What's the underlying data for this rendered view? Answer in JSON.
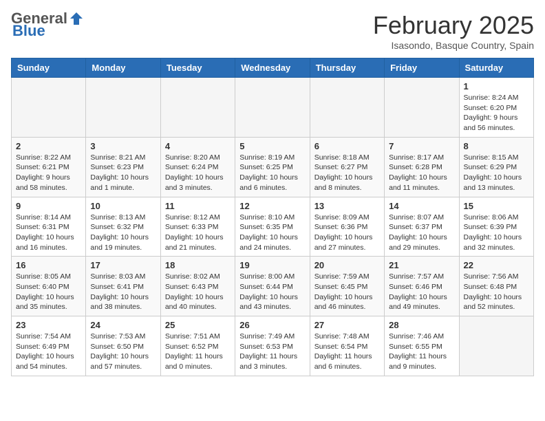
{
  "header": {
    "logo_general": "General",
    "logo_blue": "Blue",
    "month_title": "February 2025",
    "location": "Isasondo, Basque Country, Spain"
  },
  "weekdays": [
    "Sunday",
    "Monday",
    "Tuesday",
    "Wednesday",
    "Thursday",
    "Friday",
    "Saturday"
  ],
  "weeks": [
    [
      {
        "day": "",
        "info": ""
      },
      {
        "day": "",
        "info": ""
      },
      {
        "day": "",
        "info": ""
      },
      {
        "day": "",
        "info": ""
      },
      {
        "day": "",
        "info": ""
      },
      {
        "day": "",
        "info": ""
      },
      {
        "day": "1",
        "info": "Sunrise: 8:24 AM\nSunset: 6:20 PM\nDaylight: 9 hours and 56 minutes."
      }
    ],
    [
      {
        "day": "2",
        "info": "Sunrise: 8:22 AM\nSunset: 6:21 PM\nDaylight: 9 hours and 58 minutes."
      },
      {
        "day": "3",
        "info": "Sunrise: 8:21 AM\nSunset: 6:23 PM\nDaylight: 10 hours and 1 minute."
      },
      {
        "day": "4",
        "info": "Sunrise: 8:20 AM\nSunset: 6:24 PM\nDaylight: 10 hours and 3 minutes."
      },
      {
        "day": "5",
        "info": "Sunrise: 8:19 AM\nSunset: 6:25 PM\nDaylight: 10 hours and 6 minutes."
      },
      {
        "day": "6",
        "info": "Sunrise: 8:18 AM\nSunset: 6:27 PM\nDaylight: 10 hours and 8 minutes."
      },
      {
        "day": "7",
        "info": "Sunrise: 8:17 AM\nSunset: 6:28 PM\nDaylight: 10 hours and 11 minutes."
      },
      {
        "day": "8",
        "info": "Sunrise: 8:15 AM\nSunset: 6:29 PM\nDaylight: 10 hours and 13 minutes."
      }
    ],
    [
      {
        "day": "9",
        "info": "Sunrise: 8:14 AM\nSunset: 6:31 PM\nDaylight: 10 hours and 16 minutes."
      },
      {
        "day": "10",
        "info": "Sunrise: 8:13 AM\nSunset: 6:32 PM\nDaylight: 10 hours and 19 minutes."
      },
      {
        "day": "11",
        "info": "Sunrise: 8:12 AM\nSunset: 6:33 PM\nDaylight: 10 hours and 21 minutes."
      },
      {
        "day": "12",
        "info": "Sunrise: 8:10 AM\nSunset: 6:35 PM\nDaylight: 10 hours and 24 minutes."
      },
      {
        "day": "13",
        "info": "Sunrise: 8:09 AM\nSunset: 6:36 PM\nDaylight: 10 hours and 27 minutes."
      },
      {
        "day": "14",
        "info": "Sunrise: 8:07 AM\nSunset: 6:37 PM\nDaylight: 10 hours and 29 minutes."
      },
      {
        "day": "15",
        "info": "Sunrise: 8:06 AM\nSunset: 6:39 PM\nDaylight: 10 hours and 32 minutes."
      }
    ],
    [
      {
        "day": "16",
        "info": "Sunrise: 8:05 AM\nSunset: 6:40 PM\nDaylight: 10 hours and 35 minutes."
      },
      {
        "day": "17",
        "info": "Sunrise: 8:03 AM\nSunset: 6:41 PM\nDaylight: 10 hours and 38 minutes."
      },
      {
        "day": "18",
        "info": "Sunrise: 8:02 AM\nSunset: 6:43 PM\nDaylight: 10 hours and 40 minutes."
      },
      {
        "day": "19",
        "info": "Sunrise: 8:00 AM\nSunset: 6:44 PM\nDaylight: 10 hours and 43 minutes."
      },
      {
        "day": "20",
        "info": "Sunrise: 7:59 AM\nSunset: 6:45 PM\nDaylight: 10 hours and 46 minutes."
      },
      {
        "day": "21",
        "info": "Sunrise: 7:57 AM\nSunset: 6:46 PM\nDaylight: 10 hours and 49 minutes."
      },
      {
        "day": "22",
        "info": "Sunrise: 7:56 AM\nSunset: 6:48 PM\nDaylight: 10 hours and 52 minutes."
      }
    ],
    [
      {
        "day": "23",
        "info": "Sunrise: 7:54 AM\nSunset: 6:49 PM\nDaylight: 10 hours and 54 minutes."
      },
      {
        "day": "24",
        "info": "Sunrise: 7:53 AM\nSunset: 6:50 PM\nDaylight: 10 hours and 57 minutes."
      },
      {
        "day": "25",
        "info": "Sunrise: 7:51 AM\nSunset: 6:52 PM\nDaylight: 11 hours and 0 minutes."
      },
      {
        "day": "26",
        "info": "Sunrise: 7:49 AM\nSunset: 6:53 PM\nDaylight: 11 hours and 3 minutes."
      },
      {
        "day": "27",
        "info": "Sunrise: 7:48 AM\nSunset: 6:54 PM\nDaylight: 11 hours and 6 minutes."
      },
      {
        "day": "28",
        "info": "Sunrise: 7:46 AM\nSunset: 6:55 PM\nDaylight: 11 hours and 9 minutes."
      },
      {
        "day": "",
        "info": ""
      }
    ]
  ]
}
